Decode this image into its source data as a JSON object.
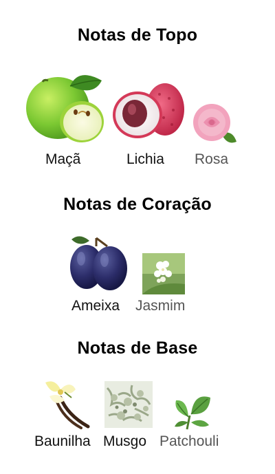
{
  "sections": [
    {
      "title": "Notas de Topo",
      "notes": [
        {
          "label": "Maçã",
          "icon": "apple-icon"
        },
        {
          "label": "Lichia",
          "icon": "lychee-icon"
        },
        {
          "label": "Rosa",
          "icon": "rose-icon"
        }
      ]
    },
    {
      "title": "Notas de Coração",
      "notes": [
        {
          "label": "Ameixa",
          "icon": "plum-icon"
        },
        {
          "label": "Jasmim",
          "icon": "jasmine-icon"
        }
      ]
    },
    {
      "title": "Notas de Base",
      "notes": [
        {
          "label": "Baunilha",
          "icon": "vanilla-icon"
        },
        {
          "label": "Musgo",
          "icon": "moss-icon"
        },
        {
          "label": "Patchouli",
          "icon": "patchouli-icon"
        }
      ]
    }
  ]
}
